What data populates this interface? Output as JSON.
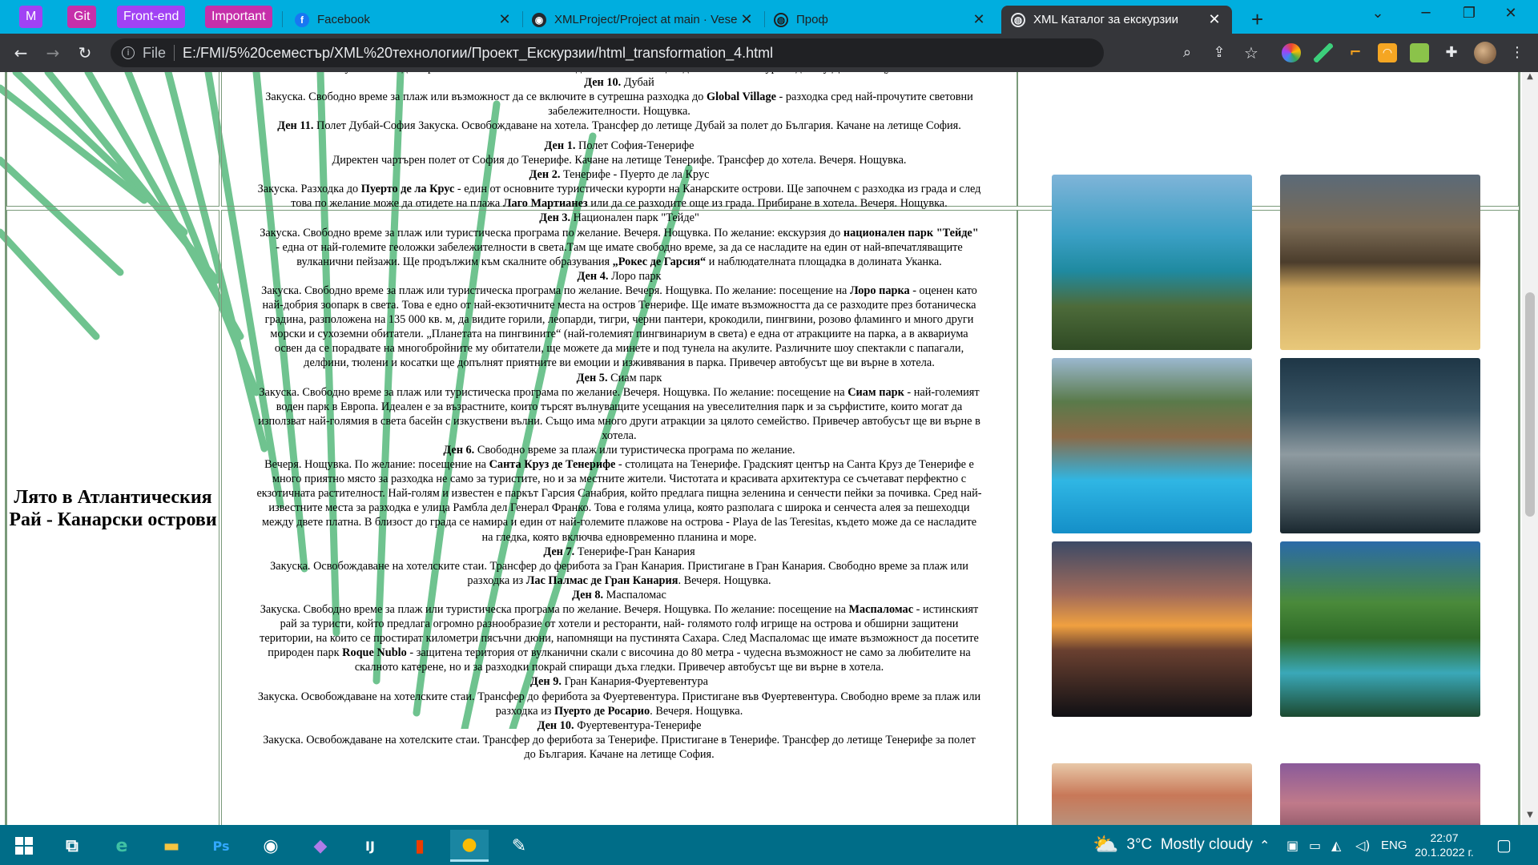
{
  "browser": {
    "bookmarks": [
      {
        "label": "M",
        "color": "#a142f4"
      },
      {
        "label": "Git",
        "color": "#c62faa"
      },
      {
        "label": "Front-end",
        "color": "#a142f4"
      },
      {
        "label": "Important",
        "color": "#c62faa"
      }
    ],
    "tabs": [
      {
        "title": "Facebook",
        "icon": "facebook-icon"
      },
      {
        "title": "XMLProject/Project at main · Vese",
        "icon": "github-icon"
      },
      {
        "title": "Проф",
        "icon": "globe-icon"
      },
      {
        "title": "XML Каталог за екскурзии",
        "icon": "globe-icon",
        "active": true
      }
    ],
    "new_tab": "+",
    "window_controls": {
      "minimize": "─",
      "maximize": "❐",
      "close": "✕",
      "tab_search": "⌄"
    },
    "address": {
      "scheme": "File",
      "url": "E:/FMI/5%20семестър/XML%20технологии/Проект_Екскурзии/html_transformation_4.html"
    }
  },
  "page": {
    "prev_row": {
      "lines": [
        "Закуска. Свободно време за плаж или възможност да се включите в целодневната ни екскурзия до Абу Даби. Нощувка.",
        [
          "b:Ден 10.",
          " Дубай"
        ],
        [
          "Закуска. Свободно време за плаж или възможност да се включите в сутрешна разходка до ",
          "b:Global Village",
          " - разходка сред най-прочутите световни"
        ],
        "забележителности. Нощувка.",
        [
          "b:Ден 11.",
          " Полет Дубай-София Закуска. Освобождаване на хотела. Трансфер до летище Дубай за полет до България. Качане на летище София."
        ]
      ]
    },
    "tour": {
      "title": "Лято в Атлантическия Рай - Канарски острови",
      "program_lines": [
        [
          "b:Ден 1.",
          " Полет София-Тенерифе"
        ],
        "Директен чартърен полет от София до Тенерифе. Качане на летище Тенерифе. Трансфер до хотела. Вечеря. Нощувка.",
        [
          "b:Ден 2.",
          " Тенерифе - Пуерто де ла Крус"
        ],
        [
          "Закуска. Разходка до ",
          "b:Пуерто де ла Крус",
          " - един от основните туристически курорти на Канарските острови. Ще започнем с разходка из града и след"
        ],
        [
          "това по желание може да отидете на плажа ",
          "b:Лаго Мартианез",
          " или да се разходите още из града. Прибиране в хотела. Вечеря. Нощувка."
        ],
        [
          "b:Ден 3.",
          " Национален парк \"Тейде\""
        ],
        [
          "Закуска. Свободно време за плаж или туристическа програма по желание. Вечеря. Нощувка. По желание: екскурзия до ",
          "b:национален парк \"Тейде\""
        ],
        "- една от най-големите геоложки забележителности в света.Там ще имате свободно време, за да се насладите на един от най-впечатляващите",
        [
          "вулканични пейзажи. Ще продължим към скалните образувания ",
          "b:„Рокес де Гарсия“",
          " и наблюдателната площадка в долината Уканка."
        ],
        [
          "b:Ден 4.",
          " Лоро парк"
        ],
        [
          "Закуска. Свободно време за плаж или туристическа програма по желание. Вечеря. Нощувка. По желание: посещение на ",
          "b:Лоро парка",
          " - оценен като"
        ],
        "най-добрия зоопарк в света. Това е едно от най-екзотичните места на остров Тенерифе. Ще имате възможността да се разходите през ботаническа",
        "градина, разположена на 135 000 кв. м, да видите горили, леопарди, тигри, черни пантери, крокодили, пингвини, розово фламинго и много други",
        "морски и сухоземни обитатели. „Планетата на пингвините“ (най-големият пингвинариум в света) е една от атракциите на парка, а в аквариума",
        "освен да се порадвате на многобройните му обитатели, ще можете да минете и под тунела на акулите. Различните шоу спектакли с папагали,",
        "делфини, тюлени и косатки ще допълнят приятните ви емоции и изживявания в парка. Привечер автобусът ще ви върне в хотела.",
        [
          "b:Ден 5.",
          " Сиам парк"
        ],
        [
          "Закуска. Свободно време за плаж или туристическа програма по желание. Вечеря. Нощувка. По желание: посещение на ",
          "b:Сиам парк",
          " - най-големият"
        ],
        "воден парк в Европа. Идеален е за възрастните, които търсят вълнуващите усещания на увеселителния парк и за сърфистите, които могат да",
        "използват най-голямия в света басейн с изкуствени вълни. Също има много други атракции за цялото семейство. Привечер автобусът ще ви върне в",
        "хотела.",
        [
          "b:Ден 6.",
          " Свободно време за плаж или туристическа програма по желание."
        ],
        [
          "Вечеря. Нощувка. По желание: посещение на ",
          "b:Санта Круз де Тенерифе",
          " - столицата на Тенерифе. Градският център на Санта Круз де Тенерифе е"
        ],
        "много приятно място за разходка не само за туристите, но и за местните жители. Чистотата и красивата архитектура се съчетават перфектно с",
        "екзотичната растителност. Най-голям и известен е паркът Гарсия Санабрия, който предлага пищна зеленина и сенчести пейки за почивка. Сред най-",
        "известните места за разходка е улица Рамбла дел Генерал Франко. Това е голяма улица, която разполага с широка и сенчеста алея за пешеходци",
        "между двете платна. В близост до града се намира и един от най-големите плажове на острова - Playa de las Teresitas, където може да се насладите",
        "на гледка, която включва едновременно планина и море.",
        [
          "b:Ден 7.",
          " Тенерифе-Гран Канария"
        ],
        "Закуска. Освобождаване на хотелските стаи. Трансфер до фериботa за Гран Канария. Пристигане в Гран Канария. Свободно време за плаж или",
        [
          "разходка из ",
          "b:Лас Палмас де Гран Канария",
          ". Вечеря. Нощувка."
        ],
        [
          "b:Ден 8.",
          " Маспаломас"
        ],
        [
          "Закуска. Свободно време за плаж или туристическа програма по желание. Вечеря. Нощувка. По желание: посещение на ",
          "b:Маспаломас",
          " - истинският"
        ],
        "рай за туристи, който предлага огромно разнообразие от хотели и ресторанти, най- голямото голф игрище на острова и обширни защитени",
        "територии, на които се простират километри пясъчни дюни, напомнящи на пустинята Сахара. След Маспаломас ще имате възможност да посетите",
        [
          "природен парк ",
          "b:Roque Nublo",
          " - защитена територия от вулканични скали с височина до 80 метра - чудесна възможност не само за любителите на"
        ],
        "скалното катерене, но и за разходки покрай спиращи дъха гледки. Привечер автобусът ще ви върне в хотела.",
        [
          "b:Ден 9.",
          " Гран Канария-Фуертевентура"
        ],
        "Закуска. Освобождаване на хотелските стаи. Трансфер до фериботa за Фуертевентура. Пристигане във Фуертевентура. Свободно време за плаж или",
        [
          "разходка из ",
          "b:Пуерто де Росарио",
          ". Вечеря. Нощувка."
        ],
        [
          "b:Ден 10.",
          " Фуертевентура-Тенерифе"
        ],
        "Закуска. Освобождаване на хотелските стаи. Трансфер до фериботa за Тенерифе. Пристигане в Тенерифе. Трансфер до летище Тенерифе за полет",
        "до България. Качане на летище София."
      ],
      "photos": [
        {
          "name": "coastal-resort-photo",
          "bg": "linear-gradient(180deg,#7fb4d8 0%,#3a9fc4 35%,#1f8aa0 55%,#4d6b3a 75%,#2f4a24 100%)"
        },
        {
          "name": "beach-rainbow-photo",
          "bg": "linear-gradient(180deg,#5b6a78 0%,#7a6a54 30%,#4b3d2c 50%,#caa35c 65%,#e8c87a 100%)"
        },
        {
          "name": "dolphin-show-photo",
          "bg": "linear-gradient(180deg,#9bb8cf 0%,#5a7a4a 25%,#8a6a48 45%,#2fb6e4 70%,#148fc8 100%)"
        },
        {
          "name": "penguin-exhibit-photo",
          "bg": "linear-gradient(180deg,#1e3646 0%,#3a5666 30%,#8e9aa0 55%,#5a6a70 75%,#1a2830 100%)"
        },
        {
          "name": "sunset-shore-photo",
          "bg": "linear-gradient(180deg,#3c4a66 0%,#a06a5a 30%,#f0a040 48%,#6a4030 62%,#101014 100%)"
        },
        {
          "name": "tropical-pool-photo",
          "bg": "linear-gradient(180deg,#2a6aa8 0%,#4a8a3a 35%,#2e6a28 55%,#3aa8b8 75%,#1c4a30 100%)"
        }
      ],
      "next_photos": [
        {
          "name": "venice-canal-photo",
          "bg": "linear-gradient(180deg,#e8c8a8 0%,#c87858 40%,#b0a090 100%)"
        },
        {
          "name": "venice-dusk-photo",
          "bg": "linear-gradient(180deg,#8a5a9a 0%,#c07a8a 50%,#7a4a5a 100%)"
        }
      ],
      "prev_photos": [
        {
          "name": "previous-tour-photo-1",
          "bg": "linear-gradient(180deg,#8aa070 0%,#b08ab0 100%)"
        },
        {
          "name": "previous-tour-photo-2",
          "bg": "linear-gradient(180deg,#7090a8 0%,#a87aa0 100%)"
        }
      ]
    }
  },
  "taskbar": {
    "apps": [
      {
        "name": "task-view-icon",
        "glyph": "⧉",
        "color": "#ffffff"
      },
      {
        "name": "edge-icon",
        "glyph": "e",
        "color": "#3fc1a4"
      },
      {
        "name": "file-explorer-icon",
        "glyph": "▬",
        "color": "#f5c542"
      },
      {
        "name": "photoshop-icon",
        "glyph": "Ps",
        "color": "#31a8ff"
      },
      {
        "name": "discord-icon",
        "glyph": "◉",
        "color": "#ffffff"
      },
      {
        "name": "visual-studio-icon",
        "glyph": "◆",
        "color": "#b07ce8"
      },
      {
        "name": "intellij-icon",
        "glyph": "IJ",
        "color": "#ffffff"
      },
      {
        "name": "office-icon",
        "glyph": "▮",
        "color": "#eb3c00"
      },
      {
        "name": "chrome-icon",
        "glyph": "●",
        "color": "#fbbc04",
        "active": true
      },
      {
        "name": "paint-icon",
        "glyph": "✎",
        "color": "#ffffff"
      }
    ],
    "weather": "3°C  Mostly cloudy",
    "language": "ENG",
    "time": "22:07",
    "date": "20.1.2022 г."
  }
}
